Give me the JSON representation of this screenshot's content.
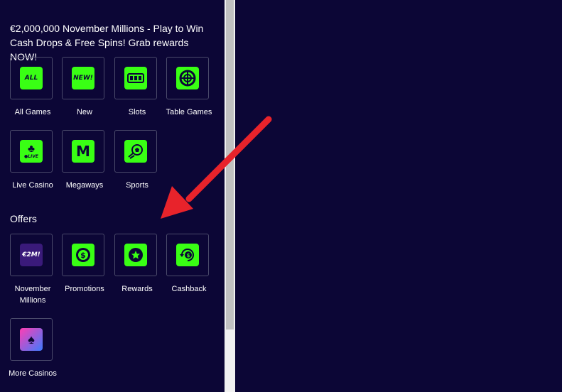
{
  "sidebar": {
    "promo_text": "€2,000,000 November Millions - Play to Win Cash Drops & Free Spins! Grab rewards NOW!",
    "games": [
      {
        "label": "All Games",
        "icon": "all-games-icon",
        "icon_text": "ALL"
      },
      {
        "label": "New",
        "icon": "new-icon",
        "icon_text": "NEW!"
      },
      {
        "label": "Slots",
        "icon": "slots-icon"
      },
      {
        "label": "Table Games",
        "icon": "roulette-icon"
      },
      {
        "label": "Live Casino",
        "icon": "club-live-icon",
        "icon_text": "●LIVE"
      },
      {
        "label": "Megaways",
        "icon": "megaways-icon",
        "icon_text": "M"
      },
      {
        "label": "Sports",
        "icon": "soccer-ball-icon"
      }
    ],
    "offers_title": "Offers",
    "offers": [
      {
        "label": "November Millions",
        "icon": "november-millions-icon",
        "icon_text": "€2M!"
      },
      {
        "label": "Promotions",
        "icon": "promotions-coin-icon"
      },
      {
        "label": "Rewards",
        "icon": "rewards-star-icon"
      },
      {
        "label": "Cashback",
        "icon": "cashback-icon"
      },
      {
        "label": "More Casinos",
        "icon": "more-casinos-icon"
      }
    ]
  },
  "colors": {
    "background": "#0c0636",
    "accent": "#39ff14",
    "tile_border": "#4a4a6a",
    "arrow": "#e8232b"
  }
}
